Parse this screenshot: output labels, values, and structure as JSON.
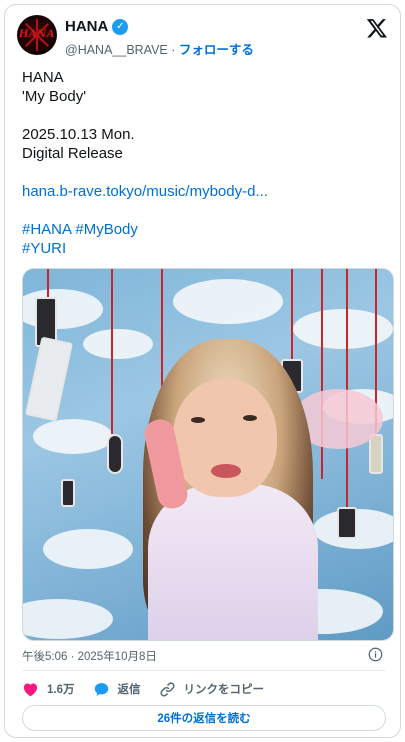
{
  "author": {
    "name": "HANA",
    "avatar_text": "HANA",
    "handle": "@HANA__BRAVE",
    "separator": "·",
    "follow_label": "フォローする"
  },
  "tweet": {
    "lines": [
      "HANA",
      "'My Body'",
      "",
      "2025.10.13 Mon.",
      "Digital Release",
      ""
    ],
    "link": "hana.b-rave.tokyo/music/mybody-d...",
    "hashtags_line1": "#HANA #MyBody",
    "hashtags_line2": "#YURI"
  },
  "meta": {
    "timestamp": "午後5:06 · 2025年10月8日"
  },
  "actions": {
    "likes": "1.6万",
    "reply_label": "返信",
    "copy_link_label": "リンクをコピー"
  },
  "read_replies_button": "26件の返信を読む",
  "colors": {
    "link": "#006fd6",
    "like": "#f91880",
    "reply": "#1d9bf0",
    "verified": "#1d9bf0"
  },
  "icons": [
    "verified-badge-icon",
    "x-logo-icon",
    "info-icon",
    "heart-icon",
    "reply-icon",
    "link-icon"
  ]
}
